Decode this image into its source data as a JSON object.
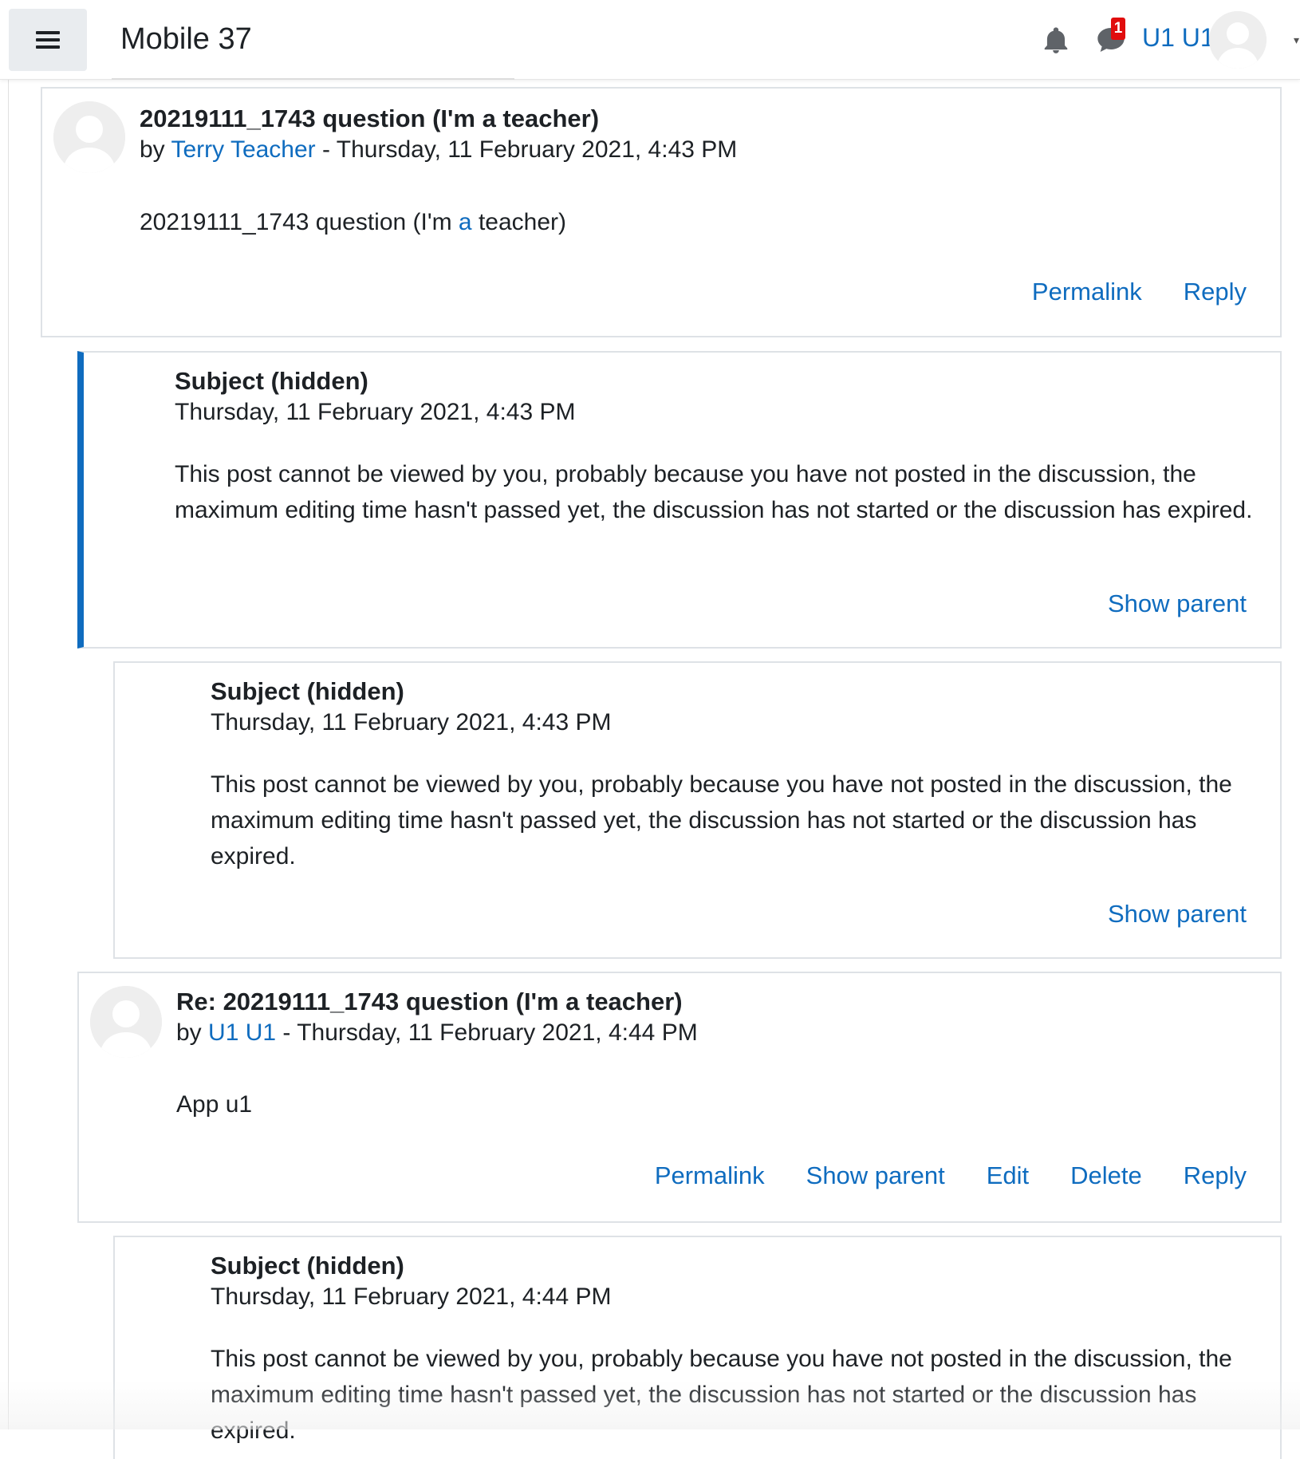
{
  "navbar": {
    "site_name": "Mobile 37",
    "notification_count": "1",
    "user_name": "U1 U1"
  },
  "posts": [
    {
      "subject": "20219111_1743 question (I'm a teacher)",
      "by": "by",
      "author": "Terry Teacher",
      "sep": " - ",
      "date": "Thursday, 11 February 2021, 4:43 PM",
      "body_pre": "20219111_1743 question (I'm ",
      "body_link": "a",
      "body_post": " teacher)",
      "actions": [
        "Permalink",
        "Reply"
      ]
    },
    {
      "subject": "Subject (hidden)",
      "date": "Thursday, 11 February 2021, 4:43 PM",
      "body": "This post cannot be viewed by you, probably because you have not posted in the discussion, the maximum editing time hasn't passed yet, the discussion has not started or the discussion has expired.",
      "actions": [
        "Show parent"
      ]
    },
    {
      "subject": "Subject (hidden)",
      "date": "Thursday, 11 February 2021, 4:43 PM",
      "body": "This post cannot be viewed by you, probably because you have not posted in the discussion, the maximum editing time hasn't passed yet, the discussion has not started or the discussion has expired.",
      "actions": [
        "Show parent"
      ]
    },
    {
      "subject": "Re: 20219111_1743 question (I'm a teacher)",
      "by": "by",
      "author": "U1 U1",
      "sep": " - ",
      "date": "Thursday, 11 February 2021, 4:44 PM",
      "body": "App u1",
      "actions": [
        "Permalink",
        "Show parent",
        "Edit",
        "Delete",
        "Reply"
      ]
    },
    {
      "subject": "Subject (hidden)",
      "date": "Thursday, 11 February 2021, 4:44 PM",
      "body": "This post cannot be viewed by you, probably because you have not posted in the discussion, the maximum editing time hasn't passed yet, the discussion has not started or the discussion has expired."
    }
  ],
  "colors": {
    "link": "#0f6cbf",
    "accent_border": "#0f6cbf",
    "badge": "#e10d0d"
  },
  "icons": [
    "hamburger-icon",
    "bell-icon",
    "message-icon",
    "user-avatar"
  ]
}
